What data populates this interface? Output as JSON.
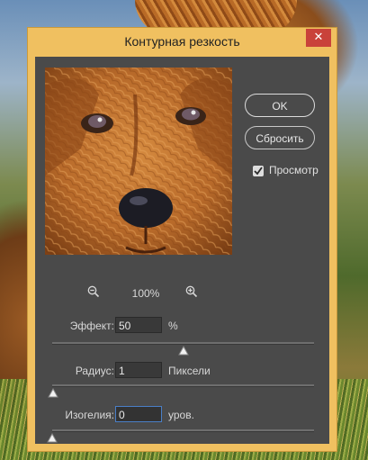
{
  "dialog": {
    "title": "Контурная резкость",
    "close_symbol": "✕",
    "ok_label": "OK",
    "reset_label": "Сбросить",
    "preview_label": "Просмотр",
    "preview_checked": true,
    "zoom_level": "100%",
    "zoom_in_icon": "zoom-in-icon",
    "zoom_out_icon": "zoom-out-icon"
  },
  "settings": {
    "effect": {
      "label": "Эффект:",
      "value": "50",
      "unit": "%",
      "slider_fraction": 0.5
    },
    "radius": {
      "label": "Радиус:",
      "value": "1",
      "unit": "Пиксели",
      "slider_fraction": 0.005
    },
    "threshold": {
      "label": "Изогелия:",
      "value": "0",
      "unit": "уров.",
      "slider_fraction": 0.0
    }
  },
  "colors": {
    "dialog_frame": "#f0c060",
    "panel": "#4a4a4a",
    "close_button": "#c9423a",
    "active_field_border": "#4a7fc7"
  }
}
